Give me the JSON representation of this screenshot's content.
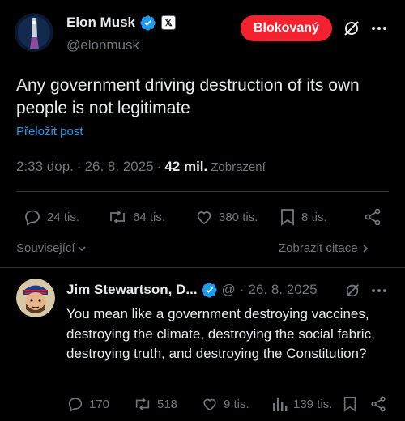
{
  "post": {
    "author_name": "Elon Musk",
    "author_handle": "@elonmusk",
    "x_badge": "𝕏",
    "blocked_label": "Blokovaný",
    "text": "Any government driving destruction of its own people is not legitimate",
    "translate_label": "Přeložit post",
    "time": "2:33 dop.",
    "date": "26. 8. 2025",
    "views_count": "42 mil.",
    "views_label": "Zobrazení",
    "stats": {
      "replies": "24 tis.",
      "reposts": "64 tis.",
      "likes": "380 tis.",
      "bookmarks": "8 tis."
    },
    "related_label": "Související",
    "quotes_label": "Zobrazit citace"
  },
  "reply": {
    "author_name": "Jim Stewartson, D...",
    "handle": "@",
    "date": "26. 8. 2025",
    "text": "You mean like a government destroying vaccines, destroying the climate, destroying the social fabric, destroying truth, and destroying the Constitution?",
    "stats": {
      "replies": "170",
      "reposts": "518",
      "likes": "9 tis.",
      "views": "139 tis."
    }
  },
  "colors": {
    "background": "#000000",
    "text": "#e7e9ea",
    "muted": "#71767b",
    "link": "#1d9bf0",
    "verified": "#1d9bf0",
    "blocked": "#f4212e",
    "divider": "#2f3336"
  },
  "icons": [
    "verified-badge",
    "x-logo",
    "grok-icon",
    "more-icon",
    "reply-icon",
    "repost-icon",
    "like-icon",
    "bookmark-icon",
    "share-icon",
    "analytics-icon",
    "chevron-down-icon",
    "chevron-right-icon"
  ]
}
